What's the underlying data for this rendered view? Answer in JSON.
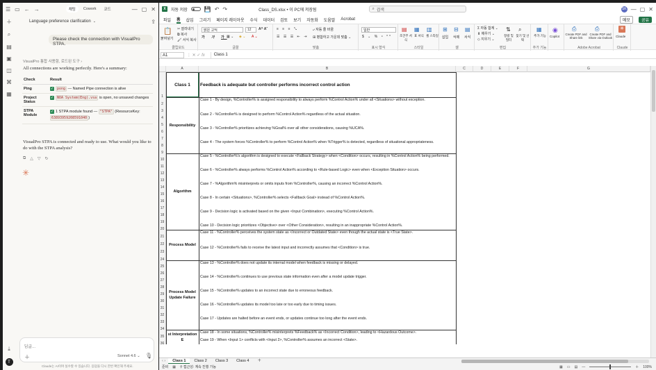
{
  "claude": {
    "conversation_title": "Language preference clarification",
    "top_tabs": [
      "채팅",
      "Cowork",
      "코드"
    ],
    "user_message": "Please check the connection with VisualPro STPA.",
    "tool_use_label": "VisualPro 통합 사용함, 로드된 도구",
    "summary": "All connections are working perfectly. Here's a summary:",
    "table_headers": [
      "Check",
      "Result"
    ],
    "rows": [
      {
        "check": "Ping",
        "code": "pong",
        "text": "— Named Pipe connection is alive"
      },
      {
        "check": "Project Status",
        "code": "NOA System(Eng).vsa",
        "text": "is open, no unsaved changes"
      },
      {
        "check": "STPA Module",
        "pre": "1 STPA module found —",
        "code": "\"STPA\"",
        "text": "(ResourceKey:",
        "code2": "63893959208591040",
        "tail": ")"
      }
    ],
    "closing": "VisualPro STPA is connected and ready to use. What would you like to do with the STPA analysis?",
    "input_placeholder": "답글...",
    "model": "Sonnet 4.6",
    "disclaimer": "Claude는 AI이며 실수할 수 있습니다. 응답을 다시 한번 확인해 주세요."
  },
  "excel": {
    "autosave": "자동 저장",
    "filename": "Class_DS.xlsx • 이 PC에 저장됨",
    "search_placeholder": "검색",
    "menus": [
      "파일",
      "홈",
      "삽입",
      "그리기",
      "페이지 레이아웃",
      "수식",
      "데이터",
      "검토",
      "보기",
      "자동화",
      "도움말",
      "Acrobat"
    ],
    "share_btns": [
      "메모",
      "공유"
    ],
    "ribbon_groups": [
      "클립보드",
      "글꼴",
      "맞춤",
      "표시 형식",
      "스타일",
      "셀",
      "편집",
      "추가 기능",
      "Adobe Acrobat",
      "Claude"
    ],
    "ribbon": {
      "paste": "붙여넣기",
      "cut": "잘라내기",
      "copy": "복사",
      "format_painter": "서식 복사",
      "font": "맑은 고딕",
      "size": "12",
      "wrap": "자동 줄 바꿈",
      "merge": "병합하고 가운데 맞춤",
      "numfmt": "일반",
      "cond": "조건부 서식",
      "table": "표 서식",
      "cellstyle": "셀 스타일",
      "insert": "삽입",
      "delete": "삭제",
      "format": "서식",
      "autosum": "자동 합계",
      "fill": "채우기",
      "clear": "지우기",
      "sort": "정렬 및 필터",
      "find": "찾기 및 선택",
      "addins": "추가 기능",
      "copilot": "Copilot",
      "pdf1": "Create PDF and Share link",
      "pdf2": "Create PDF and Share via Outlook",
      "claude": "Claude"
    },
    "name_box": "A1",
    "formula": "Class 1",
    "columns": [
      "A",
      "B",
      "C",
      "D",
      "E",
      "F",
      "G"
    ],
    "row_numbers": [
      "1",
      "2",
      "3",
      "4",
      "5",
      "6",
      "7",
      "8",
      "9",
      "10",
      "11",
      "12",
      "13",
      "14",
      "15",
      "16",
      "17",
      "18",
      "19",
      "20",
      "21",
      "22",
      "23",
      "24",
      "25",
      "26",
      "27",
      "28",
      "29",
      "30",
      "31",
      "32",
      "33",
      "34",
      "35",
      "36"
    ],
    "header_a": "Class 1",
    "header_b": "Feedback is adequate but controller performs incorrect control action",
    "categories": [
      "Responsibility",
      "Algorithm",
      "Process Model",
      "Process Model Update Failure",
      "st Interpretation E"
    ],
    "cases": [
      "Case 1 - By design, %Controller% is assigned responsibility to always perform %Control Action% under all <Situations> without exception.",
      "Case 2 - %Controller% is designed to perform %Control Action% regardless of the actual situation.",
      "Case 3 - %Controller% prioritizes achieving %Goal% over all other considerations, causing %UCA%.",
      "Case 4 - The system forces %Controller% to perform %Control Action% when %Trigger% is detected, regardless of situational appropriateness.",
      "Case 5 - %Controller%'s algorithm is designed to execute <Fallback Strategy> when <Condition> occurs, resulting in %Control Action% being performed.",
      "Case 6 - %Controller% always performs %Control Action% according to <Rule-based Logic> even when <Exception Situation> occurs.",
      "Case 7 - %Algorithm% misinterprets or omits inputs from %Controller%, causing an incorrect %Control Action%.",
      "Case 8 - In certain <Situations>, %Controller% selects <Fallback Goal> instead of %Control Action%.",
      "Case 9 - Decision logic is activated based on the given <Input Combination>, executing %Control Action%.",
      "Case 10 - Decision logic prioritizes <Objective> over <Other Consideration>, resulting in an inappropriate %Control Action%.",
      "Case 11 - %Controller% perceives the system state as <Incorrect or Outdated State> even though the actual state is <True State>.",
      "Case 12 - %Controller% fails to receive the latest input and incorrectly assumes that <Condition> is true.",
      "Case 13 - %Controller% does not update its internal model when feedback is missing or delayed.",
      "Case 14 - %Controller% continues to use previous state information even after a model update trigger.",
      "Case 15 - %Controller% updates to an incorrect state due to erroneous feedback.",
      "Case 16 - %Controller% updates its model too late or too early due to timing issues.",
      "Case 17 - Updates are halted before an event ends, or updates continue too long after the event ends.",
      "Case 18 - In some situations, %Controller% misinterprets %Feedback% as <Incorrect Condition>, leading to <Hazardous Outcome>.",
      "Case 19 - When <Input 1> conflicts with <Input 2>, %Controller% assumes an incorrect <State>."
    ],
    "sheets": [
      "Class 1",
      "Class 2",
      "Class 3",
      "Class 4"
    ],
    "status_ready": "준비",
    "status_access": "접근성: 계속 진행 가능",
    "zoom": "100%"
  }
}
